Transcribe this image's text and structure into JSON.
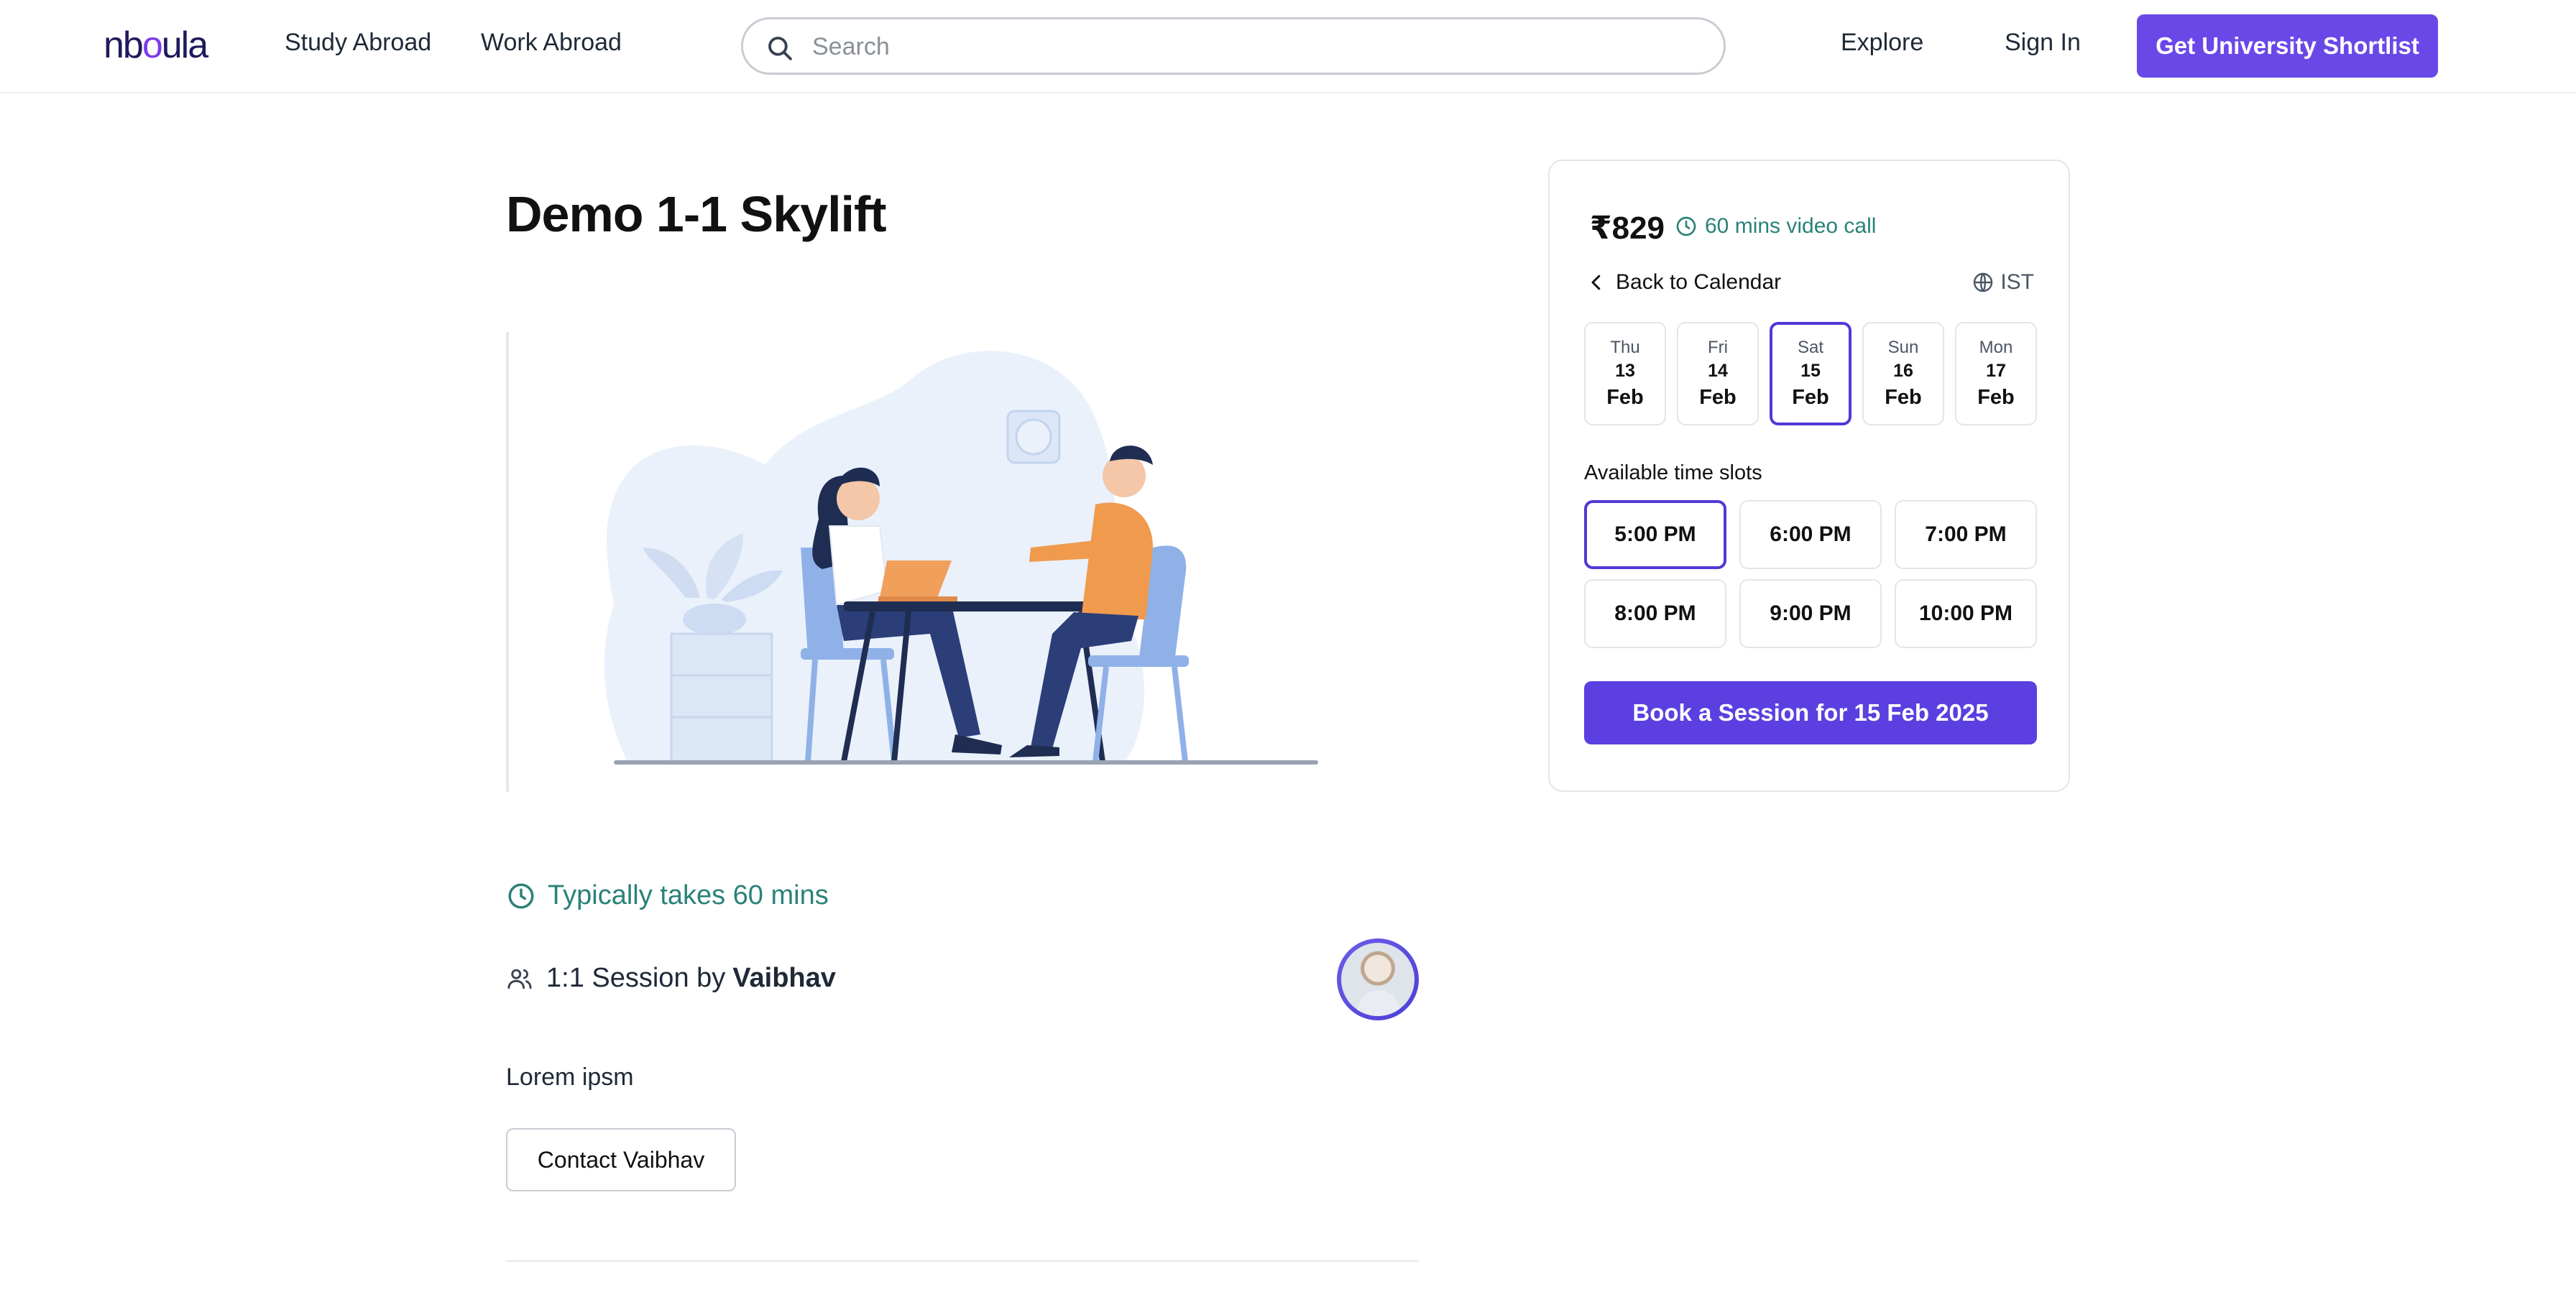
{
  "header": {
    "logo": {
      "text_pre": "nb",
      "text_o": "o",
      "text_post": "ula"
    },
    "nav": {
      "study_abroad": "Study Abroad",
      "work_abroad": "Work Abroad",
      "explore": "Explore",
      "sign_in": "Sign In"
    },
    "search": {
      "placeholder": "Search",
      "value": ""
    },
    "cta_label": "Get University Shortlist"
  },
  "main": {
    "title": "Demo 1-1 Skylift",
    "duration_text": "Typically takes 60 mins",
    "session": {
      "prefix": "1:1 Session by",
      "host": "Vaibhav"
    },
    "description": "Lorem ipsm",
    "contact_label": "Contact Vaibhav"
  },
  "booking": {
    "price": "₹829",
    "call_info": "60 mins video call",
    "back_label": "Back to Calendar",
    "timezone": "IST",
    "dates": [
      {
        "dow": "Thu",
        "day": "13",
        "month": "Feb",
        "selected": false
      },
      {
        "dow": "Fri",
        "day": "14",
        "month": "Feb",
        "selected": false
      },
      {
        "dow": "Sat",
        "day": "15",
        "month": "Feb",
        "selected": true
      },
      {
        "dow": "Sun",
        "day": "16",
        "month": "Feb",
        "selected": false
      },
      {
        "dow": "Mon",
        "day": "17",
        "month": "Feb",
        "selected": false
      }
    ],
    "slots_label": "Available time slots",
    "slots": [
      {
        "time": "5:00 PM",
        "selected": true
      },
      {
        "time": "6:00 PM",
        "selected": false
      },
      {
        "time": "7:00 PM",
        "selected": false
      },
      {
        "time": "8:00 PM",
        "selected": false
      },
      {
        "time": "9:00 PM",
        "selected": false
      },
      {
        "time": "10:00 PM",
        "selected": false
      }
    ],
    "book_label": "Book a Session for 15 Feb 2025"
  },
  "colors": {
    "accent": "#6a48e8",
    "teal": "#2a8278",
    "border": "#e3e5ea"
  },
  "icons": [
    "search-icon",
    "clock-icon",
    "users-icon",
    "chevron-left-icon",
    "globe-icon"
  ]
}
